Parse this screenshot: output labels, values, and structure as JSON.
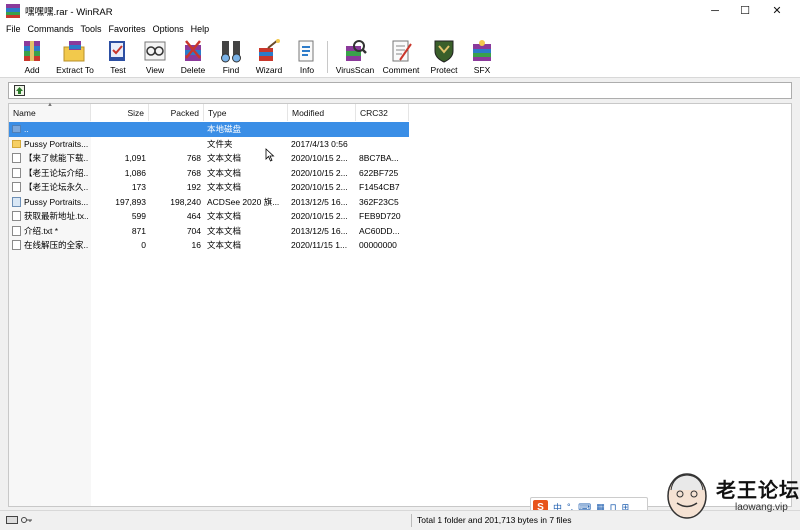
{
  "window": {
    "title": "嘿嘿嘿.rar - WinRAR",
    "minimize_glyph": "─",
    "maximize_glyph": "☐",
    "close_glyph": "✕"
  },
  "menu": [
    "File",
    "Commands",
    "Tools",
    "Favorites",
    "Options",
    "Help"
  ],
  "toolbar": [
    {
      "label": "Add",
      "icon": "add-archive-icon"
    },
    {
      "label": "Extract To",
      "icon": "extract-to-icon"
    },
    {
      "label": "Test",
      "icon": "test-icon"
    },
    {
      "label": "View",
      "icon": "view-icon"
    },
    {
      "label": "Delete",
      "icon": "delete-icon"
    },
    {
      "label": "Find",
      "icon": "find-icon"
    },
    {
      "label": "Wizard",
      "icon": "wizard-icon"
    },
    {
      "label": "Info",
      "icon": "info-icon"
    },
    {
      "label": "VirusScan",
      "icon": "virus-scan-icon"
    },
    {
      "label": "Comment",
      "icon": "comment-icon"
    },
    {
      "label": "Protect",
      "icon": "protect-icon"
    },
    {
      "label": "SFX",
      "icon": "sfx-icon"
    }
  ],
  "columns": {
    "name": "Name",
    "size": "Size",
    "packed": "Packed",
    "type": "Type",
    "modified": "Modified",
    "crc": "CRC32"
  },
  "files": [
    {
      "name": "..",
      "size": "",
      "packed": "",
      "type": "本地磁盘",
      "modified": "",
      "crc": "",
      "icon": "parent-folder-icon",
      "selected": true
    },
    {
      "name": "Pussy Portraits...",
      "size": "",
      "packed": "",
      "type": "文件夹",
      "modified": "2017/4/13 0:56",
      "crc": "",
      "icon": "folder-icon",
      "selected": false
    },
    {
      "name": "【来了就能下载...",
      "size": "1,091",
      "packed": "768",
      "type": "文本文档",
      "modified": "2020/10/15 2...",
      "crc": "8BC7BA...",
      "icon": "text-file-icon",
      "selected": false
    },
    {
      "name": "【老王论坛介绍...",
      "size": "1,086",
      "packed": "768",
      "type": "文本文档",
      "modified": "2020/10/15 2...",
      "crc": "622BF725",
      "icon": "text-file-icon",
      "selected": false
    },
    {
      "name": "【老王论坛永久...",
      "size": "173",
      "packed": "192",
      "type": "文本文档",
      "modified": "2020/10/15 2...",
      "crc": "F1454CB7",
      "icon": "text-file-icon",
      "selected": false
    },
    {
      "name": "Pussy Portraits...",
      "size": "197,893",
      "packed": "198,240",
      "type": "ACDSee 2020 旗...",
      "modified": "2013/12/5 16...",
      "crc": "362F23C5",
      "icon": "image-file-icon",
      "selected": false
    },
    {
      "name": "获取最新地址.tx...",
      "size": "599",
      "packed": "464",
      "type": "文本文档",
      "modified": "2020/10/15 2...",
      "crc": "FEB9D720",
      "icon": "text-file-icon",
      "selected": false
    },
    {
      "name": "介绍.txt *",
      "size": "871",
      "packed": "704",
      "type": "文本文档",
      "modified": "2013/12/5 16...",
      "crc": "AC60DD...",
      "icon": "text-file-icon",
      "selected": false
    },
    {
      "name": "在线解压的全家...",
      "size": "0",
      "packed": "16",
      "type": "文本文档",
      "modified": "2020/11/15 1...",
      "crc": "00000000",
      "icon": "text-file-icon",
      "selected": false
    }
  ],
  "status": {
    "text": "Total 1 folder and 201,713 bytes in 7 files"
  },
  "ime": {
    "logo": "S",
    "items": [
      "中",
      "°,",
      "⌨",
      "▦",
      "⊓",
      "⊞"
    ]
  },
  "watermark": {
    "title": "老王论坛",
    "url": "laowang.vip"
  },
  "colors": {
    "selection": "#3a8ee6",
    "ime_brand": "#e8541c"
  }
}
